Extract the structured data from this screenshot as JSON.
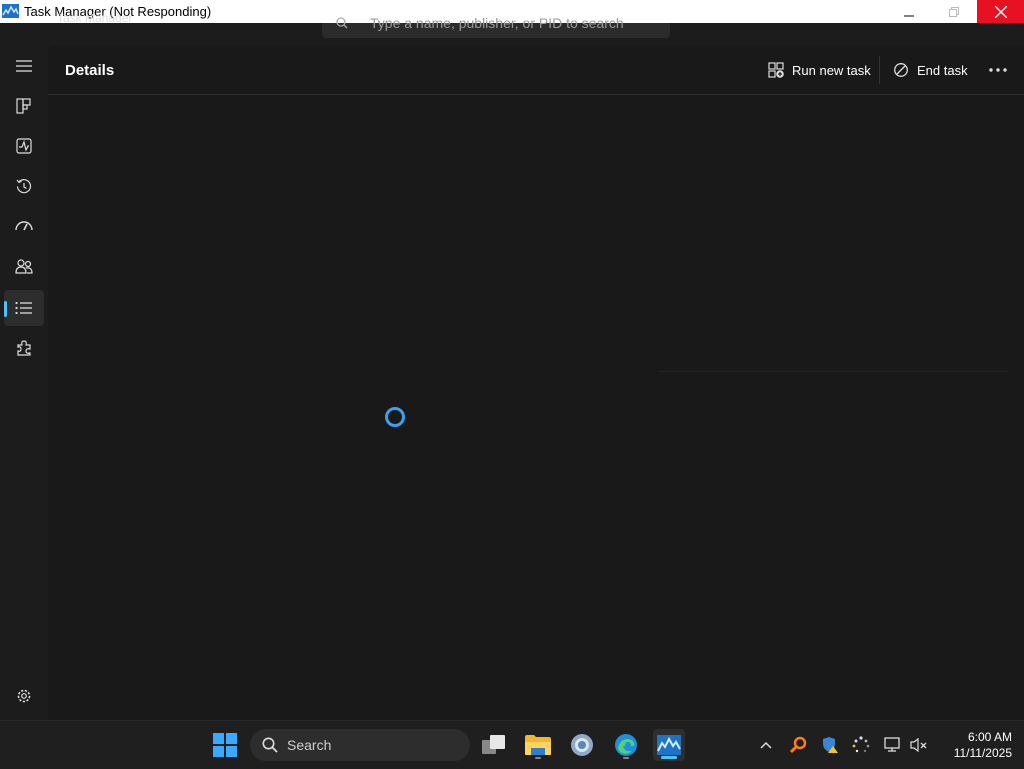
{
  "window": {
    "title": "Task Manager (Not Responding)",
    "app_name": "Task Manager"
  },
  "search": {
    "placeholder": "Type a name, publisher, or PID to search"
  },
  "nav": {
    "items": [
      {
        "name": "processes",
        "icon": "grid-icon"
      },
      {
        "name": "performance",
        "icon": "pulse-icon"
      },
      {
        "name": "app-history",
        "icon": "history-icon"
      },
      {
        "name": "startup-apps",
        "icon": "speedometer-icon"
      },
      {
        "name": "users",
        "icon": "users-icon"
      },
      {
        "name": "details",
        "icon": "list-icon",
        "selected": true
      },
      {
        "name": "services",
        "icon": "puzzle-icon"
      }
    ],
    "settings_icon": "gear-icon"
  },
  "commandbar": {
    "title": "Details",
    "run_new_task": "Run new task",
    "end_task": "End task"
  },
  "taskbar": {
    "search_label": "Search",
    "time": "6:00 AM",
    "date": "11/11/2025"
  },
  "colors": {
    "accent": "#4cc2ff",
    "close": "#e81123",
    "spinner": "#3aa0f0"
  }
}
